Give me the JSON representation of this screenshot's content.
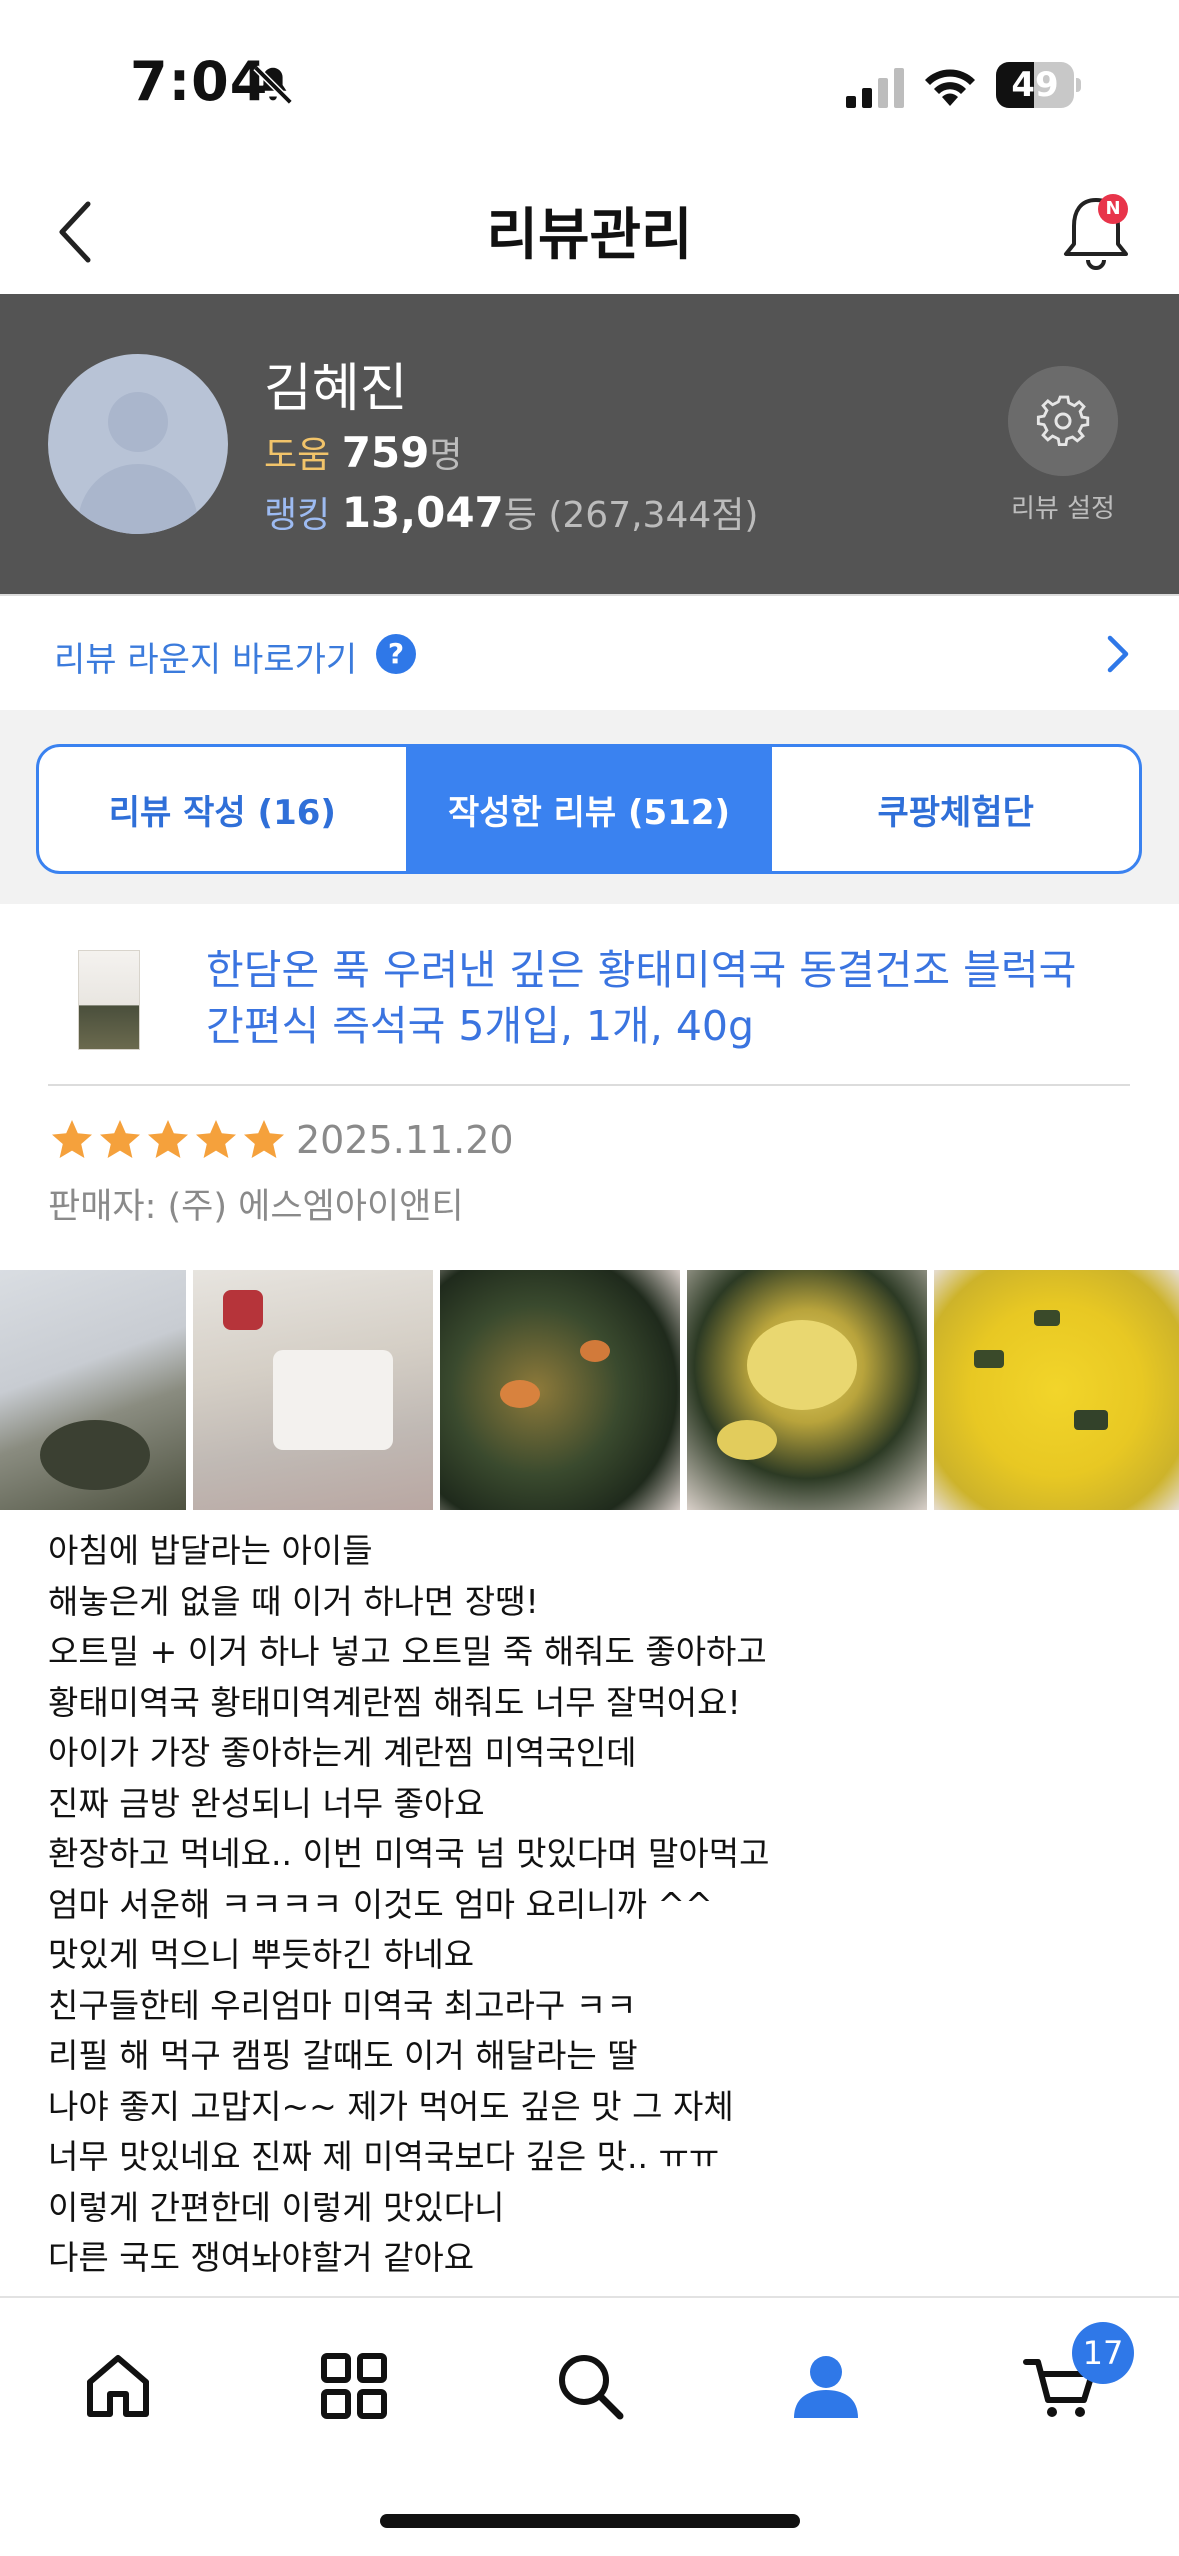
{
  "status_bar": {
    "time": "7:04",
    "battery": "49",
    "battery_level": 0.49
  },
  "header": {
    "title": "리뷰관리",
    "notification_badge": "N"
  },
  "profile": {
    "name": "김혜진",
    "help_label": "도움",
    "help_count": "759",
    "help_unit": "명",
    "rank_label": "랭킹",
    "rank_value": "13,047",
    "rank_unit": "등",
    "rank_points": "(267,344점)",
    "settings_label": "리뷰 설정"
  },
  "lounge": {
    "label": "리뷰 라운지 바로가기",
    "help_icon": "?"
  },
  "tabs": [
    {
      "label": "리뷰 작성 (16)",
      "active": false
    },
    {
      "label": "작성한 리뷰 (512)",
      "active": true
    },
    {
      "label": "쿠팡체험단",
      "active": false
    }
  ],
  "review": {
    "product_title": "한담온 푹 우려낸 깊은 황태미역국 동결건조 블럭국 간편식 즉석국 5개입, 1개, 40g",
    "rating": 5,
    "rating_max": 5,
    "date": "2025.11.20",
    "seller": "판매자: (주) 에스엠아이앤티",
    "star_color": "#f5a13c",
    "lines": [
      "아침에 밥달라는 아이들",
      "해놓은게 없을 때 이거 하나면 장땡!",
      "오트밀 + 이거 하나 넣고 오트밀 죽 해줘도 좋아하고",
      "황태미역국 황태미역계란찜 해줘도 너무 잘먹어요!",
      "아이가 가장 좋아하는게 계란찜 미역국인데",
      "진짜 금방 완성되니 너무 좋아요",
      "환장하고 먹네요.. 이번 미역국 넘 맛있다며 말아먹고",
      "엄마 서운해 ㅋㅋㅋㅋ 이것도 엄마 요리니까 ^^",
      "맛있게 먹으니 뿌듯하긴 하네요",
      "친구들한테 우리엄마 미역국 최고라구 ㅋㅋ",
      "리필 해 먹구 캠핑 갈때도 이거 해달라는 딸",
      "나야 좋지 고맙지~~ 제가 먹어도 깊은 맛 그 자체",
      "너무 맛있네요 진짜 제 미역국보다 깊은 맛.. ㅠㅠ",
      "이렇게 간편한데 이렇게 맛있다니",
      "다른 국도 쟁여놔야할거 같아요"
    ]
  },
  "bottom_nav": {
    "items": [
      "home-icon",
      "category-grid-icon",
      "search-icon",
      "my-profile-icon",
      "cart-icon"
    ],
    "cart_badge": "17",
    "active_color": "#2f78e8"
  }
}
